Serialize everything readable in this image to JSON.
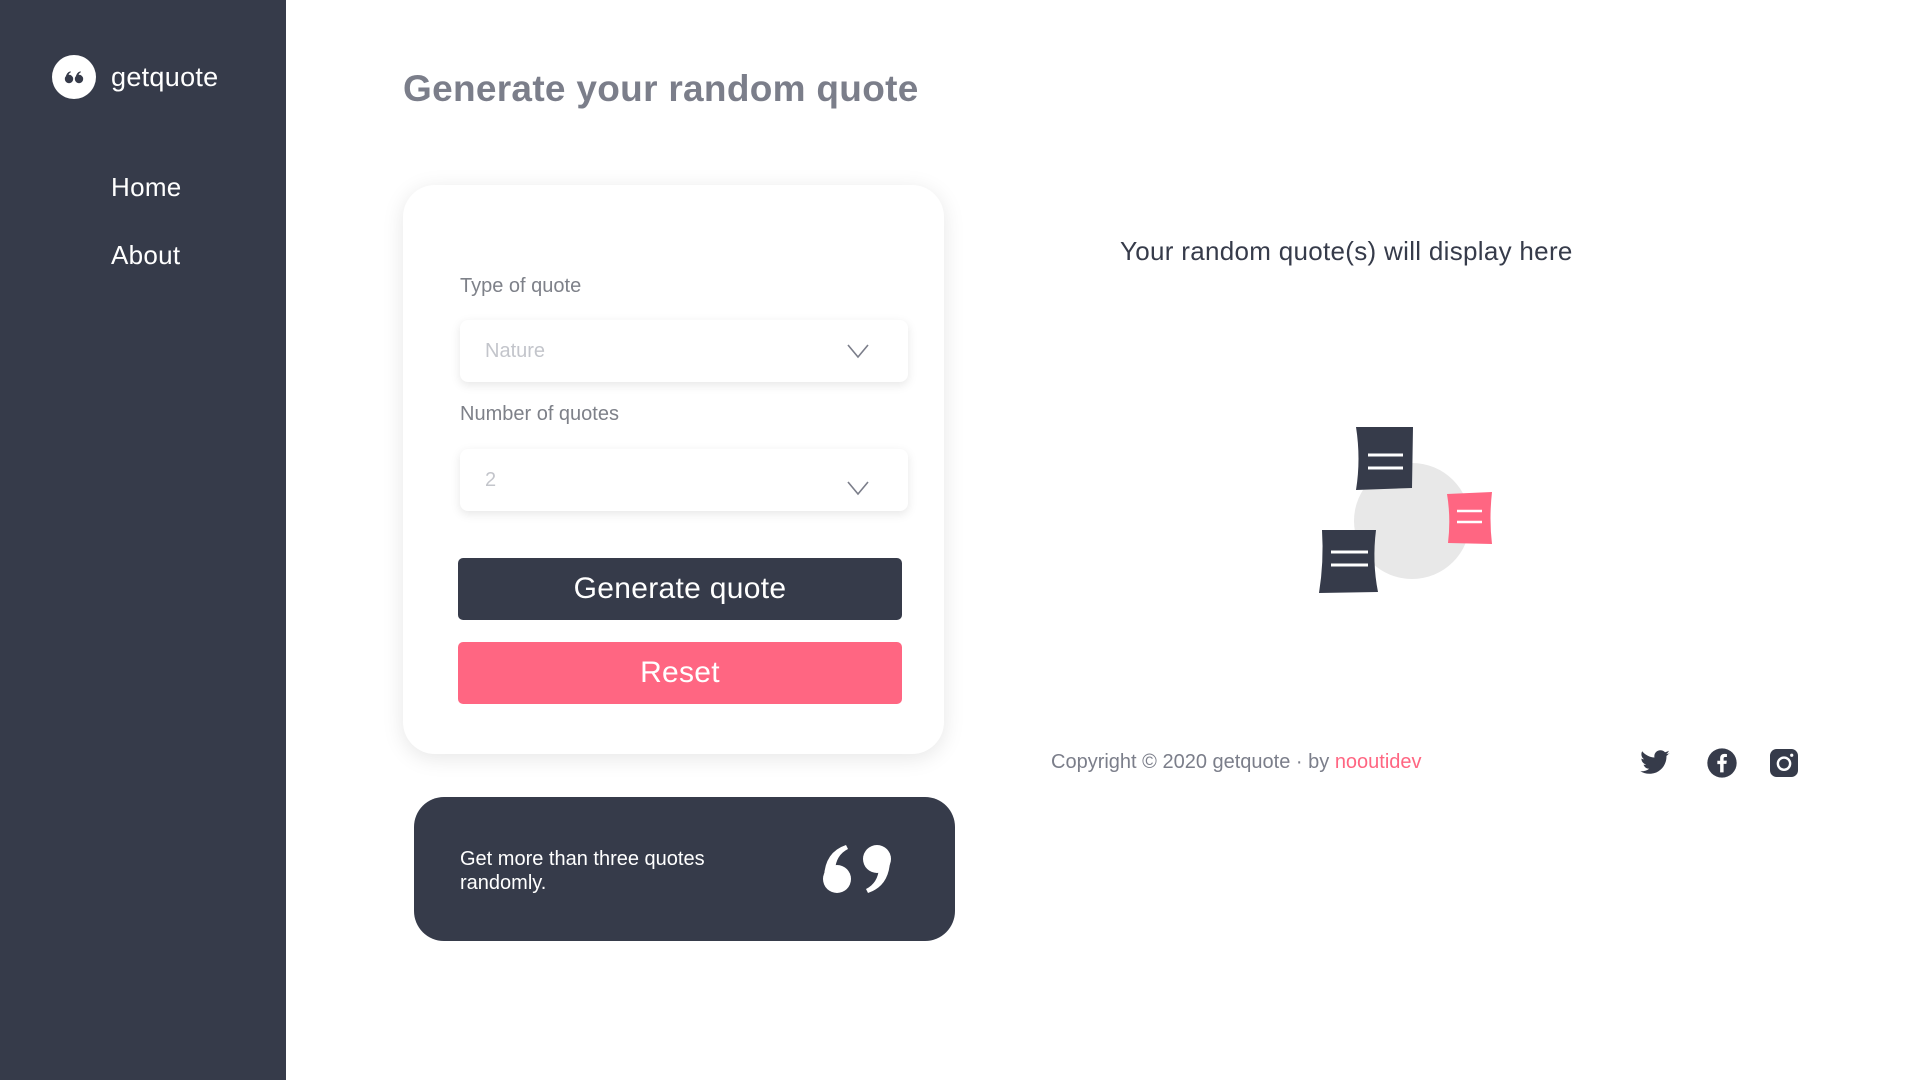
{
  "brand": {
    "name": "getquote"
  },
  "nav": {
    "items": [
      {
        "label": "Home"
      },
      {
        "label": "About"
      }
    ]
  },
  "page": {
    "title": "Generate your random quote"
  },
  "form": {
    "type_label": "Type of quote",
    "type_value": "Nature",
    "number_label": "Number of quotes",
    "number_value": "2",
    "generate_label": "Generate quote",
    "reset_label": "Reset"
  },
  "promo": {
    "text": "Get more than three quotes\n randomly."
  },
  "display": {
    "placeholder": "Your random quote(s) will display here"
  },
  "footer": {
    "copyright_prefix": "Copyright © 2020 getquote · by ",
    "author": "nooutidev"
  },
  "social": {
    "icons": [
      "twitter-icon",
      "facebook-icon",
      "instagram-icon"
    ]
  },
  "colors": {
    "dark": "#363b4a",
    "accent": "#ff6682",
    "muted": "#7b7e8a"
  }
}
